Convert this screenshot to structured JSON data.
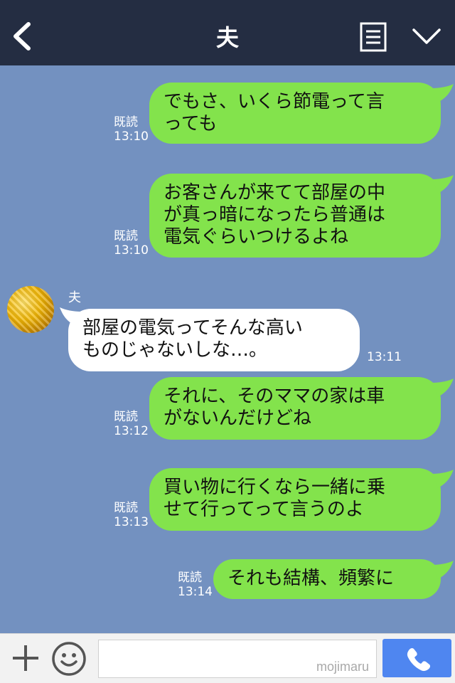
{
  "header": {
    "title": "夫",
    "back_icon": "chevron-left-icon",
    "menu_icon": "menu-icon",
    "collapse_icon": "chevron-down-icon",
    "background": "#242d42"
  },
  "messages": [
    {
      "side": "mine",
      "text": "でもさ、いくら節電って言\nっても",
      "read": "既読",
      "time": "13:10"
    },
    {
      "side": "mine",
      "text": "お客さんが来てて部屋の中\nが真っ暗になったら普通は\n電気ぐらいつけるよね",
      "read": "既読",
      "time": "13:10"
    },
    {
      "side": "theirs",
      "sender": "夫",
      "text": "部屋の電気ってそんな高い\nものじゃないしな…。",
      "time": "13:11"
    },
    {
      "side": "mine",
      "text": "それに、そのママの家は車\nがないんだけどね",
      "read": "既読",
      "time": "13:12"
    },
    {
      "side": "mine",
      "text": "買い物に行くなら一緒に乗\nせて行ってって言うのよ",
      "read": "既読",
      "time": "13:13"
    },
    {
      "side": "mine",
      "text": "それも結構、頻繁に",
      "read": "既読",
      "time": "13:14"
    }
  ],
  "input": {
    "placeholder": "",
    "watermark": "mojimaru",
    "plus_icon": "plus-icon",
    "emoji_icon": "emoji-icon",
    "call_icon": "phone-icon"
  },
  "colors": {
    "chat_background": "#7391c0",
    "my_bubble": "#83e34c",
    "their_bubble": "#ffffff",
    "call_button": "#4f86f0"
  }
}
